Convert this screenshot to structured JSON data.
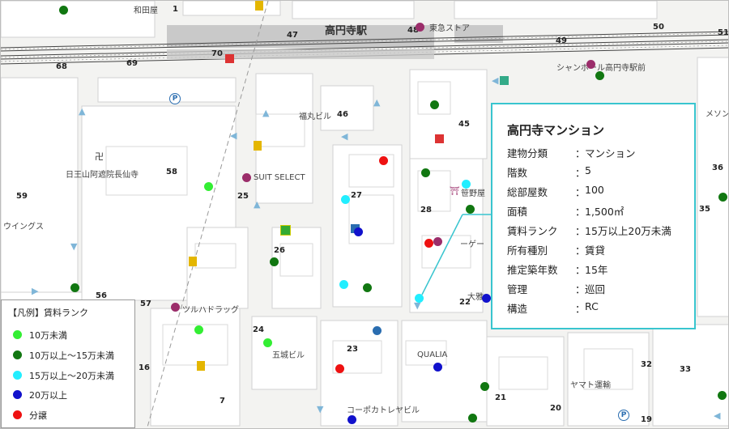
{
  "station": {
    "name": "高円寺駅"
  },
  "block_numbers": [
    "1",
    "47",
    "48",
    "49",
    "50",
    "51",
    "68",
    "69",
    "70",
    "46",
    "45",
    "58",
    "59",
    "25",
    "27",
    "28",
    "26",
    "35",
    "36",
    "56",
    "57",
    "24",
    "23",
    "21",
    "22",
    "20",
    "19",
    "32",
    "33",
    "7",
    "16"
  ],
  "place_labels": {
    "wadayashiki": "和田屋",
    "tokyu": "東急ストア",
    "chanpon": "シャンポール高円寺駅前",
    "fukumaru": "福丸ビル",
    "nichiozan": "日王山阿遮院長仙寺",
    "suit_select": "SUIT SELECT",
    "sanyou": "笹野屋",
    "ge": "ーゲー",
    "wings": "ウイングス",
    "tsuruha": "ツルハドラッグ",
    "gojo": "五城ビル",
    "qualia": "QUALIA",
    "daiwa": "大雅",
    "yamato": "ヤマト運輸",
    "copo": "コーポカトレヤビル",
    "meson": "メソン"
  },
  "legend": {
    "title": "【凡例】賃料ランク",
    "items": [
      {
        "label": "10万未満",
        "color": "#33ee33"
      },
      {
        "label": "10万以上～15万未満",
        "color": "#117711"
      },
      {
        "label": "15万以上～20万未満",
        "color": "#22eeff"
      },
      {
        "label": "20万以上",
        "color": "#1111cc"
      },
      {
        "label": "分譲",
        "color": "#ee1111"
      }
    ]
  },
  "info": {
    "title": "高円寺マンション",
    "sep": "：",
    "rows": [
      {
        "key": "建物分類",
        "value": "マンション"
      },
      {
        "key": "階数",
        "value": "5"
      },
      {
        "key": "総部屋数",
        "value": "100"
      },
      {
        "key": "面積",
        "value": "1,500㎡"
      },
      {
        "key": "賃料ランク",
        "value": "15万以上20万未満"
      },
      {
        "key": "所有種別",
        "value": "賃貸"
      },
      {
        "key": "推定築年数",
        "value": "15年"
      },
      {
        "key": "管理",
        "value": "巡回"
      },
      {
        "key": "構造",
        "value": "RC"
      }
    ]
  },
  "colors": {
    "accent": "#39c5cf"
  }
}
